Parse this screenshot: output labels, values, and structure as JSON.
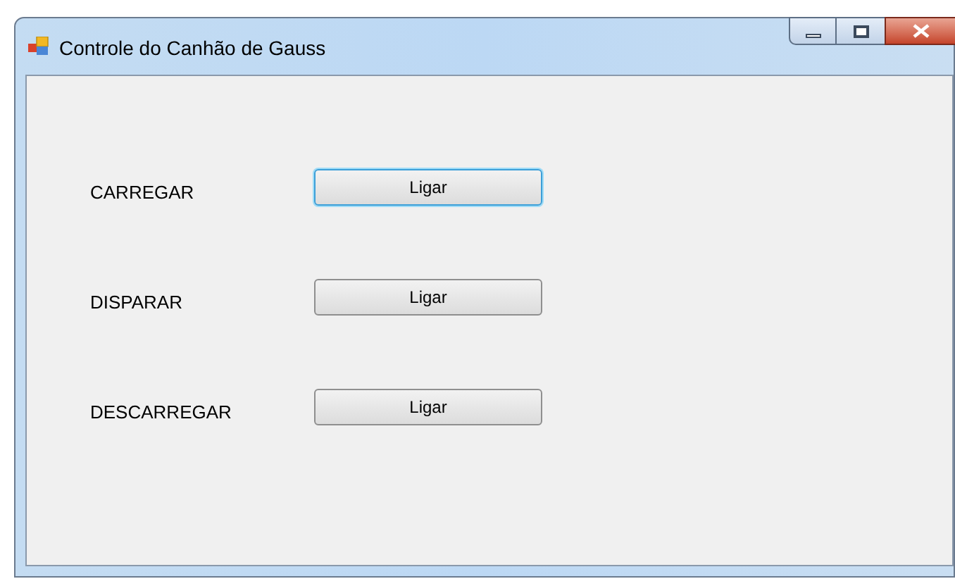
{
  "window": {
    "title": "Controle do Canhão de Gauss"
  },
  "rows": [
    {
      "label": "CARREGAR",
      "button": "Ligar",
      "focused": true
    },
    {
      "label": "DISPARAR",
      "button": "Ligar",
      "focused": false
    },
    {
      "label": "DESCARREGAR",
      "button": "Ligar",
      "focused": false
    }
  ]
}
